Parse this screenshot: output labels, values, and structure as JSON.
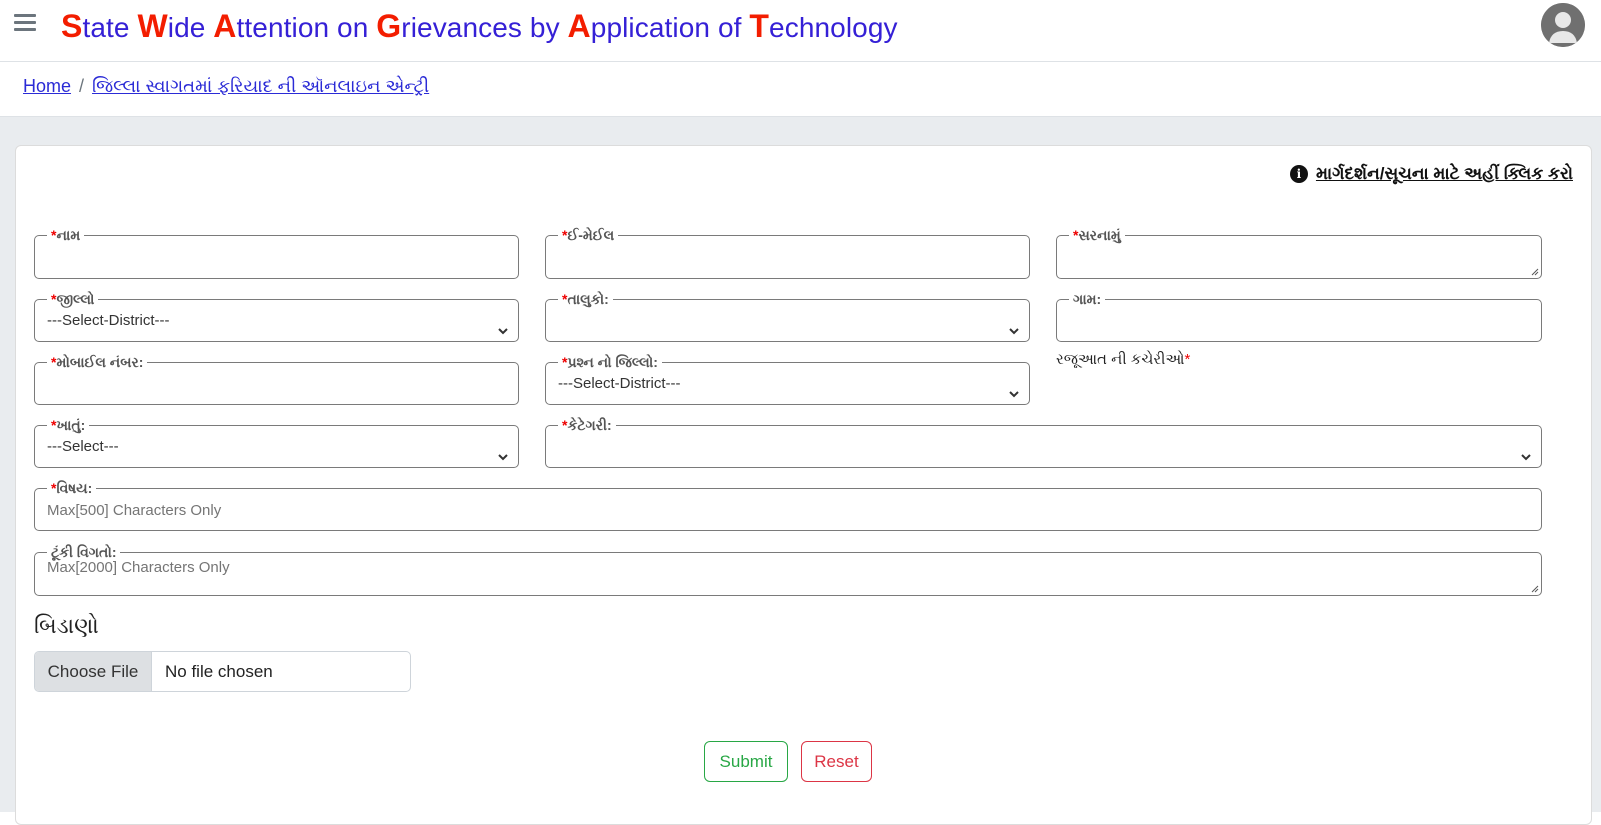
{
  "header": {
    "title_parts": [
      {
        "cap": "S",
        "rest": "tate "
      },
      {
        "cap": "W",
        "rest": "ide "
      },
      {
        "cap": "A",
        "rest": "ttention on "
      },
      {
        "cap": "G",
        "rest": "rievances by "
      },
      {
        "cap": "A",
        "rest": "pplication of "
      },
      {
        "cap": "T",
        "rest": "echnology"
      }
    ],
    "menu_icon": "hamburger-icon",
    "avatar_icon": "user-avatar-icon"
  },
  "breadcrumb": {
    "home": "Home",
    "separator": "/",
    "current": "જિલ્લા સ્વાગતમાં ફરિયાદ ની ઑનલાઇન એન્ટ્રી"
  },
  "form": {
    "help_link": "માર્ગદર્શન/સૂચના માટે અહીં ક્લિક કરો",
    "help_icon": "info-icon",
    "required_mark": "*",
    "fields": {
      "name": {
        "label": "નામ",
        "value": ""
      },
      "email": {
        "label": "ઈ-મેઈલ",
        "value": ""
      },
      "address": {
        "label": "સરનામું",
        "value": ""
      },
      "district": {
        "label": "જીલ્લો",
        "selected": "---Select-District---"
      },
      "taluka": {
        "label": "તાલુકો:",
        "selected": ""
      },
      "village": {
        "label": "ગામ:",
        "value": ""
      },
      "mobile": {
        "label": "મોબાઈલ નંબર:",
        "value": ""
      },
      "question_district": {
        "label": "પ્રશ્ન નો જિલ્લો:",
        "selected": "---Select-District---"
      },
      "offices": {
        "label": "રજૂઆત ની કચેરીઓ"
      },
      "department": {
        "label": "ખાતું:",
        "selected": "---Select---"
      },
      "category": {
        "label": "કેટેગરી:",
        "selected": ""
      },
      "subject": {
        "label": "વિષય:",
        "placeholder": "Max[500] Characters Only"
      },
      "details": {
        "label": "ટૂંકી વિગતો:",
        "placeholder": "Max[2000] Characters Only"
      }
    },
    "attachment": {
      "title": "બિડાણો",
      "button": "Choose File",
      "status": "No file chosen"
    },
    "buttons": {
      "submit": "Submit",
      "reset": "Reset"
    }
  }
}
